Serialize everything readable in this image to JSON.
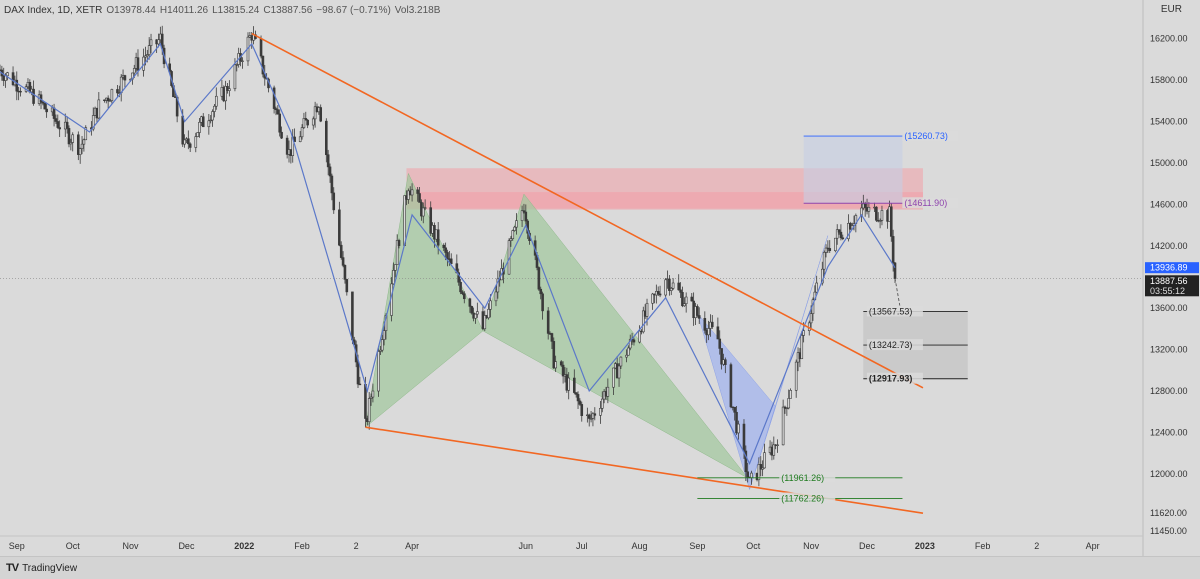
{
  "header": {
    "symbol": "DAX Index, 1D, XETR",
    "open": "O13978.44",
    "high": "H14011.26",
    "low": "L13815.24",
    "close": "C13887.56",
    "change": "−98.67 (−0.71%)",
    "volume": "Vol3.218B",
    "currency": "EUR"
  },
  "branding": {
    "name": "TradingView"
  },
  "colors": {
    "background": "#dadada",
    "candle": "#3a3a3a",
    "ma_line": "#5b78c9",
    "trendline": "#f26722",
    "supply_zone": "#f2a0a8",
    "harmonic_green": "#a4c8a0",
    "harmonic_blue": "#9fb2f0",
    "target_box": "#c8c8c8",
    "price_label_bg": "#2962ff"
  },
  "chart_data": {
    "type": "candlestick",
    "title": "DAX Index, 1D, XETR",
    "ylim": [
      11400,
      16400
    ],
    "xlim": [
      "2021-08-23",
      "2023-04-28"
    ],
    "price_ticks": [
      16200,
      15800,
      15400,
      15000,
      14600,
      14200,
      13600,
      13200,
      12800,
      12400,
      12000,
      11620,
      11450
    ],
    "price_tick_labels": [
      "16200.00",
      "15800.00",
      "15400.00",
      "15000.00",
      "14600.00",
      "14200.00",
      "13600.00",
      "13200.00",
      "12800.00",
      "12400.00",
      "12000.00",
      "11620.00",
      "11450.00"
    ],
    "time_ticks": [
      {
        "label": "Sep",
        "date": "2021-09-01",
        "bold": false
      },
      {
        "label": "Oct",
        "date": "2021-10-01",
        "bold": false
      },
      {
        "label": "Nov",
        "date": "2021-11-01",
        "bold": false
      },
      {
        "label": "Dec",
        "date": "2021-12-01",
        "bold": false
      },
      {
        "label": "2022",
        "date": "2022-01-01",
        "bold": true
      },
      {
        "label": "Feb",
        "date": "2022-02-01",
        "bold": false
      },
      {
        "label": "2",
        "date": "2022-03-02",
        "bold": false
      },
      {
        "label": "Apr",
        "date": "2022-04-01",
        "bold": false
      },
      {
        "label": "Jun",
        "date": "2022-06-01",
        "bold": false
      },
      {
        "label": "Jul",
        "date": "2022-07-01",
        "bold": false
      },
      {
        "label": "Aug",
        "date": "2022-08-01",
        "bold": false
      },
      {
        "label": "Sep",
        "date": "2022-09-01",
        "bold": false
      },
      {
        "label": "Oct",
        "date": "2022-10-01",
        "bold": false
      },
      {
        "label": "Nov",
        "date": "2022-11-01",
        "bold": false
      },
      {
        "label": "Dec",
        "date": "2022-12-01",
        "bold": false
      },
      {
        "label": "2023",
        "date": "2023-01-01",
        "bold": true
      },
      {
        "label": "Feb",
        "date": "2023-02-01",
        "bold": false
      },
      {
        "label": "2",
        "date": "2023-03-02",
        "bold": false
      },
      {
        "label": "Apr",
        "date": "2023-04-01",
        "bold": false
      }
    ],
    "path_anchors": [
      [
        "2021-08-23",
        15900
      ],
      [
        "2021-09-10",
        15650
      ],
      [
        "2021-10-05",
        15150
      ],
      [
        "2021-10-15",
        15550
      ],
      [
        "2021-11-17",
        16200
      ],
      [
        "2021-11-30",
        15150
      ],
      [
        "2021-12-22",
        15700
      ],
      [
        "2022-01-05",
        16250
      ],
      [
        "2022-01-25",
        15100
      ],
      [
        "2022-02-10",
        15600
      ],
      [
        "2022-03-07",
        12450
      ],
      [
        "2022-03-30",
        14800
      ],
      [
        "2022-05-09",
        13400
      ],
      [
        "2022-05-31",
        14600
      ],
      [
        "2022-06-16",
        13100
      ],
      [
        "2022-07-05",
        12500
      ],
      [
        "2022-08-15",
        13900
      ],
      [
        "2022-09-12",
        13300
      ],
      [
        "2022-09-29",
        11900
      ],
      [
        "2022-10-13",
        12300
      ],
      [
        "2022-11-10",
        14200
      ],
      [
        "2022-11-28",
        14550
      ],
      [
        "2022-12-13",
        14500
      ],
      [
        "2022-12-16",
        13887
      ]
    ],
    "moving_average_anchors": [
      [
        "2021-08-23",
        15880
      ],
      [
        "2021-10-10",
        15300
      ],
      [
        "2021-11-17",
        16150
      ],
      [
        "2021-11-30",
        15400
      ],
      [
        "2022-01-05",
        16150
      ],
      [
        "2022-01-26",
        15300
      ],
      [
        "2022-03-08",
        12800
      ],
      [
        "2022-04-01",
        14500
      ],
      [
        "2022-05-10",
        13600
      ],
      [
        "2022-06-01",
        14400
      ],
      [
        "2022-07-05",
        12800
      ],
      [
        "2022-08-15",
        13700
      ],
      [
        "2022-09-29",
        12100
      ],
      [
        "2022-11-10",
        14000
      ],
      [
        "2022-11-28",
        14500
      ],
      [
        "2022-12-16",
        13990
      ]
    ],
    "supply_zones": [
      {
        "from": "2022-03-29",
        "to": "2022-12-31",
        "top": 14950,
        "bottom": 14550
      },
      {
        "from": "2022-03-29",
        "to": "2022-12-31",
        "top": 14720,
        "bottom": 14560
      }
    ],
    "trendlines": [
      {
        "from": [
          "2022-01-05",
          16250
        ],
        "to": [
          "2022-12-31",
          12830
        ]
      },
      {
        "from": [
          "2022-03-07",
          12450
        ],
        "to": [
          "2022-12-31",
          11620
        ]
      }
    ],
    "green_pattern": {
      "points": [
        [
          "2022-03-07",
          12450
        ],
        [
          "2022-03-30",
          14900
        ],
        [
          "2022-05-09",
          13380
        ],
        [
          "2022-05-31",
          14700
        ],
        [
          "2022-09-28",
          11960
        ]
      ],
      "triangles": [
        [
          0,
          1,
          2
        ],
        [
          2,
          3,
          4
        ]
      ]
    },
    "blue_pattern": {
      "points": [
        [
          "2022-09-01",
          13550
        ],
        [
          "2022-09-29",
          11850
        ],
        [
          "2022-10-13",
          12650
        ],
        [
          "2022-11-10",
          14300
        ]
      ],
      "triangles": [
        [
          0,
          1,
          2
        ],
        [
          1,
          2,
          3
        ]
      ]
    },
    "projection": {
      "from": [
        "2022-12-16",
        13887
      ],
      "to": [
        "2022-12-19",
        13580
      ]
    },
    "target_box": {
      "from": "2022-11-29",
      "to": "2023-01-24",
      "top": 13567.53,
      "bottom": 12917.93
    },
    "levels": [
      {
        "label": "(15260.73)",
        "price": 15260.73,
        "from": "2022-10-28",
        "to": "2022-12-20",
        "color": "#2962ff",
        "label_date": "2022-12-21",
        "bold": false
      },
      {
        "label": "(14611.90)",
        "price": 14611.9,
        "from": "2022-10-28",
        "to": "2022-12-20",
        "color": "#8e44ad",
        "label_date": "2022-12-21",
        "bold": false
      },
      {
        "label": "(13567.53)",
        "price": 13567.53,
        "from": "2022-11-29",
        "to": "2023-01-24",
        "color": "#222222",
        "label_date": "2022-12-02",
        "bold": false
      },
      {
        "label": "(13242.73)",
        "price": 13242.73,
        "from": "2022-11-29",
        "to": "2023-01-24",
        "color": "#222222",
        "label_date": "2022-12-02",
        "bold": false
      },
      {
        "label": "(12917.93)",
        "price": 12917.93,
        "from": "2022-11-29",
        "to": "2023-01-24",
        "color": "#222222",
        "label_date": "2022-12-02",
        "bold": true
      },
      {
        "label": "(11961.26)",
        "price": 11961.26,
        "from": "2022-09-01",
        "to": "2022-12-20",
        "color": "#1e7a1e",
        "label_date": "2022-10-16",
        "bold": false
      },
      {
        "label": "(11762.26)",
        "price": 11762.26,
        "from": "2022-09-01",
        "to": "2022-12-20",
        "color": "#1e7a1e",
        "label_date": "2022-10-16",
        "bold": false
      }
    ],
    "volume_box": {
      "from": "2022-10-28",
      "to": "2022-12-20",
      "top": 15260.73,
      "bottom": 14611.9
    },
    "last_price": {
      "value": 13887.56,
      "label": "13887.56",
      "countdown": "03:55:12"
    },
    "prev_price": {
      "value": 13936.89,
      "label": "13936.89"
    }
  }
}
